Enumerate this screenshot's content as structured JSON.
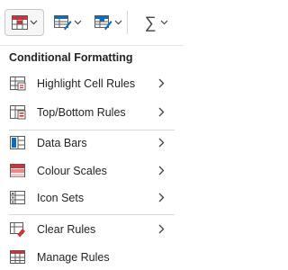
{
  "ribbon": {
    "buttons": [
      {
        "name": "conditional-formatting-button",
        "icon": "conditional-formatting-icon",
        "active": true
      },
      {
        "name": "format-as-table-button",
        "icon": "format-table-icon",
        "active": false
      },
      {
        "name": "cell-styles-button",
        "icon": "cell-styles-icon",
        "active": false
      },
      {
        "name": "autosum-button",
        "icon": "sigma-icon",
        "active": false
      }
    ],
    "sum_symbol": "∑"
  },
  "menu": {
    "title": "Conditional Formatting",
    "items": [
      {
        "label": "Highlight Cell Rules",
        "icon": "highlight-cell-rules-icon",
        "has_submenu": true
      },
      {
        "label": "Top/Bottom Rules",
        "icon": "top-bottom-rules-icon",
        "has_submenu": true
      },
      {
        "label": "Data Bars",
        "icon": "data-bars-icon",
        "has_submenu": true
      },
      {
        "label": "Colour Scales",
        "icon": "colour-scales-icon",
        "has_submenu": true
      },
      {
        "label": "Icon Sets",
        "icon": "icon-sets-icon",
        "has_submenu": true
      },
      {
        "label": "Clear Rules",
        "icon": "clear-rules-icon",
        "has_submenu": true
      },
      {
        "label": "Manage Rules",
        "icon": "manage-rules-icon",
        "has_submenu": false
      }
    ]
  },
  "colors": {
    "accent_red": "#d13438",
    "accent_blue": "#0f6cbd",
    "text": "#242424"
  }
}
